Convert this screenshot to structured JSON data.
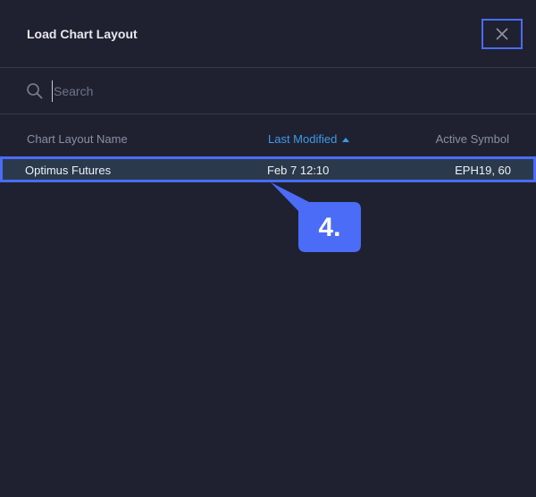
{
  "dialog": {
    "title": "Load Chart Layout",
    "close_icon": "close-icon"
  },
  "search": {
    "placeholder": "Search",
    "value": "",
    "icon": "search-icon"
  },
  "columns": {
    "name": "Chart Layout Name",
    "modified": "Last Modified",
    "symbol": "Active Symbol",
    "sort_icon": "sort-ascending-icon"
  },
  "rows": [
    {
      "name": "Optimus Futures",
      "modified": "Feb 7 12:10",
      "symbol": "EPH19, 60"
    }
  ],
  "annotation": {
    "label": "4.",
    "color": "#4a6cf7"
  },
  "colors": {
    "background": "#1f2131",
    "accent_blue": "#3f9be6",
    "highlight_border": "#4a6cf7",
    "row_selected": "#2a3a4c"
  }
}
